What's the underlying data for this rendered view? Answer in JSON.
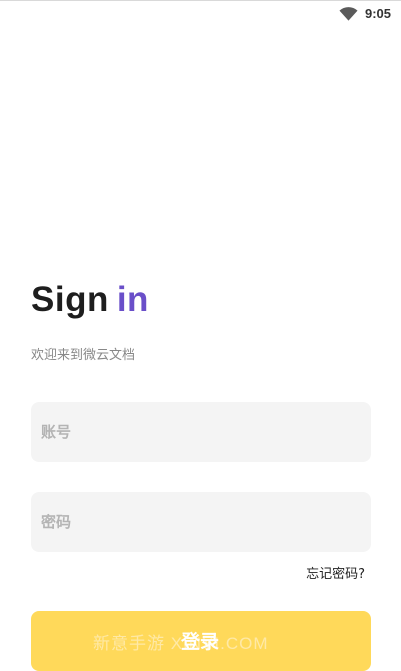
{
  "status_bar": {
    "time": "9:05",
    "wifi_icon": "wifi-icon"
  },
  "header": {
    "title_main": "Sign",
    "title_accent": "in",
    "subtitle": "欢迎来到微云文档"
  },
  "form": {
    "account_placeholder": "账号",
    "password_placeholder": "密码",
    "forgot_label": "忘记密码?"
  },
  "login": {
    "label": "登录",
    "watermark": "新意手游 XINYI.COM"
  },
  "colors": {
    "accent": "#6a4fc9",
    "button": "#ffd95a",
    "field_bg": "#f4f4f4"
  }
}
